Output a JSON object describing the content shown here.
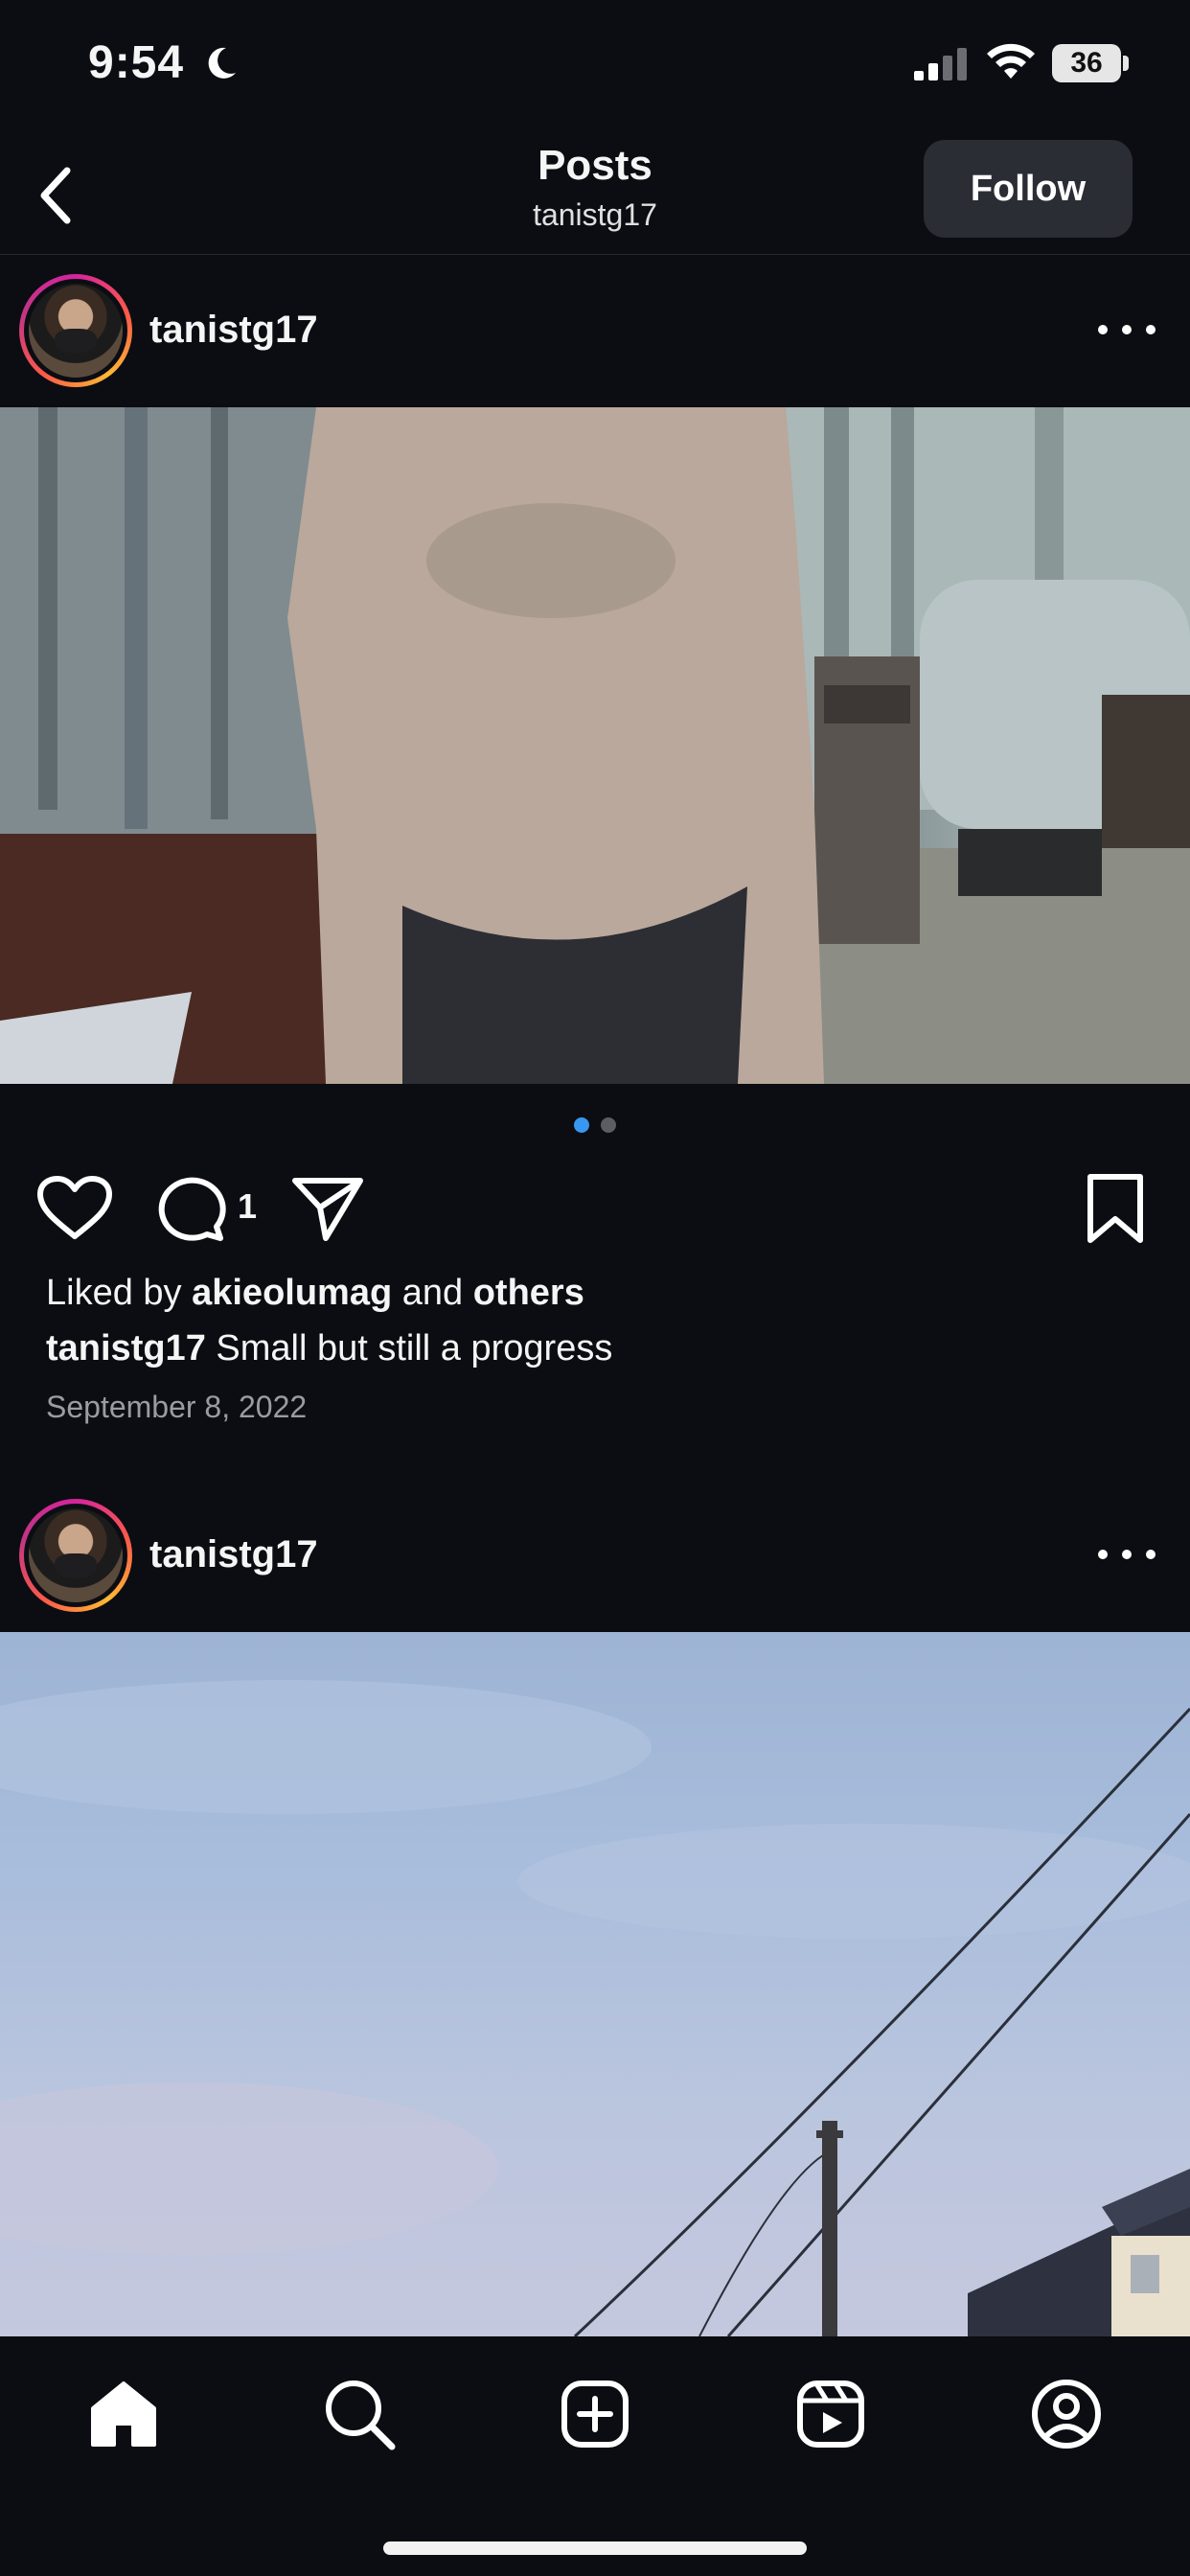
{
  "status_bar": {
    "time": "9:54",
    "battery": "36"
  },
  "header": {
    "title": "Posts",
    "subtitle": "tanistg17",
    "follow_label": "Follow"
  },
  "posts": [
    {
      "username": "tanistg17",
      "carousel": {
        "count": 2,
        "active_index": 0
      },
      "comment_count": "1",
      "liked_prefix": "Liked by",
      "liked_user": "akieolumag",
      "liked_and": "and",
      "liked_others": "others",
      "caption_username": "tanistg17",
      "caption_text": "Small but still a progress",
      "date": "September 8, 2022"
    },
    {
      "username": "tanistg17"
    }
  ],
  "bottom_nav": {
    "tabs": [
      "home-icon",
      "search-icon",
      "create-icon",
      "reels-icon",
      "profile-icon"
    ],
    "active": "home-icon"
  },
  "colors": {
    "background": "#0b0d12",
    "active_dot": "#3897f0"
  }
}
